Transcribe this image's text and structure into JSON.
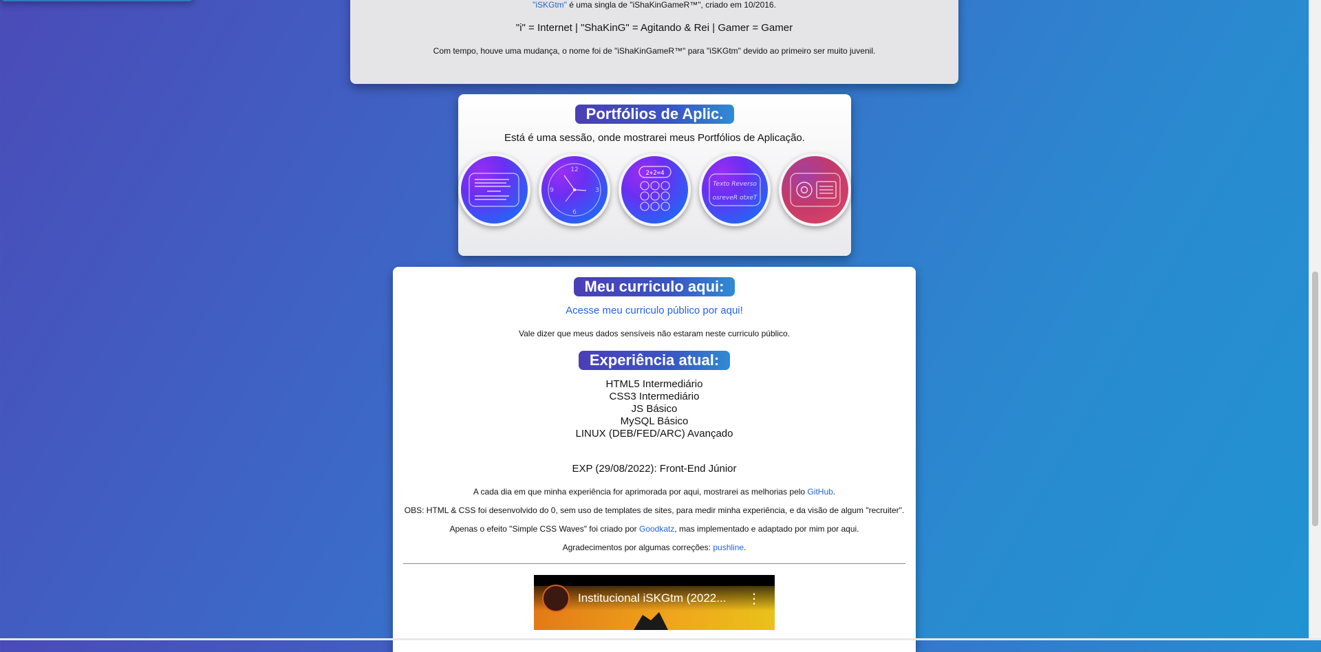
{
  "about": {
    "line1_link": "\"iSKGtm\"",
    "line1_rest": " é uma singla de \"iShaKinGameR™\", criado em 10/2016.",
    "meaning": "\"i\" = Internet | \"ShaKinG\" = Agitando & Rei | Gamer = Gamer",
    "change": "Com tempo, houve uma mudança, o nome foi de \"iShaKinGameR™\" para \"iSKGtm\" devido ao primeiro ser muito juvenil."
  },
  "portfolio": {
    "title": "Portfólios de Aplic.",
    "subtitle": "Está é uma sessão, onde mostrarei meus Portfólios de Aplicação.",
    "items": [
      {
        "icon": "form-icon",
        "color": "#3b4ef5"
      },
      {
        "icon": "clock-icon",
        "color": "#3b4ef5"
      },
      {
        "icon": "calculator-icon",
        "color": "#3b4ef5",
        "display": "2+2=4"
      },
      {
        "icon": "reverse-text-icon",
        "color": "#3b4ef5",
        "text_top": "Texto Reverso",
        "text_bottom": "osreveR otxeT"
      },
      {
        "icon": "email-icon",
        "color": "#d83d66"
      }
    ]
  },
  "cv": {
    "title": "Meu curriculo aqui:",
    "link": "Acesse meu curriculo público por aqui!",
    "note": "Vale dizer que meus dados sensíveis não estaram neste curriculo público."
  },
  "experience": {
    "title": "Experiência atual:",
    "skills": [
      "HTML5 Intermediário",
      "CSS3 Intermediário",
      "JS Básico",
      "MySQL Básico",
      "LINUX (DEB/FED/ARC) Avançado"
    ],
    "exp": "EXP (29/08/2022): Front-End Júnior",
    "daily_pre": "A cada dia em que minha experiência for aprimorada por aqui, mostrarei as melhorias pelo ",
    "daily_link": "GitHub",
    "daily_post": ".",
    "obs": "OBS: HTML & CSS foi desenvolvido do 0, sem uso de templates de sites, para medir minha experiência, e da visão de algum \"recruiter\".",
    "waves_pre": "Apenas o efeito \"Simple CSS Waves\" foi criado por ",
    "waves_link": "Goodkatz",
    "waves_post": ", mas implementado e adaptado por mim por aqui.",
    "thanks_pre": "Agradecimentos por algumas correções: ",
    "thanks_link": "pushline",
    "thanks_post": "."
  },
  "video": {
    "title": "Institucional iSKGtm (2022...",
    "menu": "⋮"
  }
}
